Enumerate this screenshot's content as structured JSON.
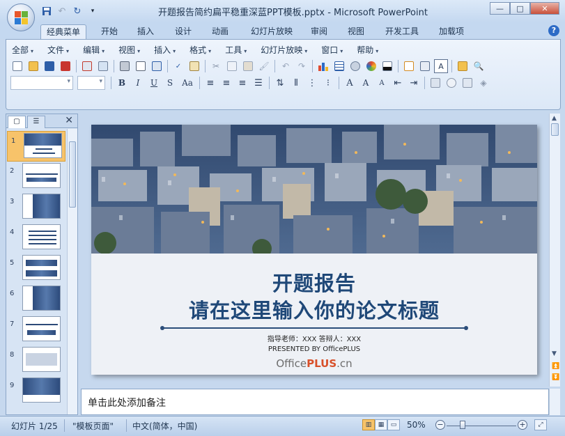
{
  "window": {
    "title": "开题报告简约扁平稳重深蓝PPT模板.pptx - Microsoft PowerPoint",
    "minimize": "—",
    "maximize": "□",
    "close": "✕"
  },
  "quick_access": [
    "save-icon",
    "undo-icon",
    "redo-icon",
    "customize-icon"
  ],
  "ribbon_tabs": [
    {
      "label": "经典菜单",
      "active": true
    },
    {
      "label": "开始"
    },
    {
      "label": "插入"
    },
    {
      "label": "设计"
    },
    {
      "label": "动画"
    },
    {
      "label": "幻灯片放映"
    },
    {
      "label": "审阅"
    },
    {
      "label": "视图"
    },
    {
      "label": "开发工具"
    },
    {
      "label": "加载项"
    }
  ],
  "help_label": "?",
  "menus": [
    "全部",
    "文件",
    "编辑",
    "视图",
    "插入",
    "格式",
    "工具",
    "幻灯片放映",
    "窗口",
    "帮助"
  ],
  "toolbar_row2_icons": [
    "new-icon",
    "open-icon",
    "save-icon",
    "pdf-icon",
    "permission-icon",
    "attach-icon",
    "print-icon",
    "print-preview-icon",
    "layout-icon",
    "spelling-icon",
    "research-icon",
    "cut-icon",
    "copy-icon",
    "paste-icon",
    "format-painter-icon",
    "undo-icon",
    "redo-icon",
    "chart-icon",
    "table-icon",
    "clipart-icon",
    "color-icon",
    "new-slide-icon",
    "slide-layout-icon",
    "textbox-icon",
    "open-folder-icon",
    "find-icon"
  ],
  "toolbar_row3": {
    "bold": "B",
    "italic": "I",
    "underline": "U",
    "strike": "S",
    "case": "Aa",
    "grow_font": "A",
    "shrink_font": "A"
  },
  "thumbnails": [
    {
      "num": "1",
      "selected": true
    },
    {
      "num": "2"
    },
    {
      "num": "3"
    },
    {
      "num": "4"
    },
    {
      "num": "5"
    },
    {
      "num": "6"
    },
    {
      "num": "7"
    },
    {
      "num": "8"
    },
    {
      "num": "9"
    }
  ],
  "slide": {
    "title": "开题报告",
    "subtitle": "请在这里输入你的论文标题",
    "advisor": "指导老师：XXX 答辩人：XXX",
    "presented": "PRESENTED BY OfficePLUS",
    "brand_prefix": "Office",
    "brand_plus": "PLUS",
    "brand_suffix": ".cn"
  },
  "notes_placeholder": "单击此处添加备注",
  "status": {
    "slide_info": "幻灯片 1/25",
    "template": "\"模板页面\"",
    "language": "中文(简体，中国)",
    "zoom": "50%",
    "zoom_level_percent": 50
  },
  "colors": {
    "title_blue": "#1f4878",
    "brand_orange": "#d8502a",
    "selected_thumb": "#f7c36a"
  }
}
